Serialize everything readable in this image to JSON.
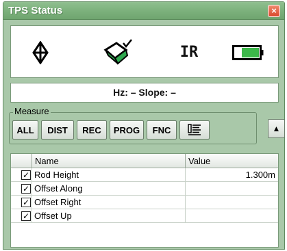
{
  "window": {
    "title": "TPS Status",
    "close_glyph": "×"
  },
  "icons": [
    {
      "name": "prism-target-icon"
    },
    {
      "name": "compensator-level-icon",
      "accent": "#2fa84f"
    },
    {
      "name": "ir-mode",
      "label": "IR"
    },
    {
      "name": "battery-icon",
      "accent": "#3cb84a"
    }
  ],
  "status": {
    "text": "Hz: –  Slope: –"
  },
  "measure": {
    "label": "Measure",
    "buttons": [
      "ALL",
      "DIST",
      "REC",
      "PROG",
      "FNC"
    ],
    "list_icon": "list-settings-icon",
    "up_glyph": "▲"
  },
  "table": {
    "columns": [
      "Name",
      "Value"
    ],
    "rows": [
      {
        "checked": true,
        "name": "Rod Height",
        "value": "1.300m"
      },
      {
        "checked": true,
        "name": "Offset Along",
        "value": ""
      },
      {
        "checked": true,
        "name": "Offset Right",
        "value": ""
      },
      {
        "checked": true,
        "name": "Offset Up",
        "value": ""
      }
    ],
    "check_glyph": "✓"
  }
}
